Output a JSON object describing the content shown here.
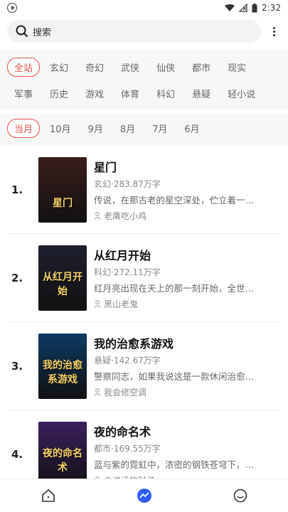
{
  "status": {
    "time": "2:32"
  },
  "search": {
    "placeholder": "搜索"
  },
  "categories": [
    "全站",
    "玄幻",
    "奇幻",
    "武侠",
    "仙侠",
    "都市",
    "现实",
    "军事",
    "历史",
    "游戏",
    "体育",
    "科幻",
    "悬疑",
    "轻小说"
  ],
  "months": [
    "当月",
    "10月",
    "9月",
    "8月",
    "7月",
    "6月"
  ],
  "books": [
    {
      "rank": "1.",
      "title": "星门",
      "meta": "玄幻·283.87万字",
      "desc": "传说，在那古老的星空深处，伫立着一…",
      "author": "老鹰吃小鸡",
      "cover_text": "星门",
      "cover_color": "#3a1e1a"
    },
    {
      "rank": "2.",
      "title": "从红月开始",
      "meta": "科幻·272.11万字",
      "desc": "红月亮出现在天上的那一刻开始，全世…",
      "author": "黑山老鬼",
      "cover_text": "从红月开始",
      "cover_color": "#1e1f2e"
    },
    {
      "rank": "3.",
      "title": "我的治愈系游戏",
      "meta": "悬疑·142.67万字",
      "desc": "警察同志，如果我说这是一款休闲治愈…",
      "author": "我会修空调",
      "cover_text": "我的治愈系游戏",
      "cover_color": "#0d3a62"
    },
    {
      "rank": "4.",
      "title": "夜的命名术",
      "meta": "都市·169.55万字",
      "desc": "蓝与紫的霓虹中，浓密的钢铁苍穹下，…",
      "author": "会说话的肘子",
      "cover_text": "夜的命名术",
      "cover_color": "#3b1f5e"
    }
  ],
  "colors": {
    "accent": "#e8524a",
    "nav_active": "#2f5bff"
  }
}
